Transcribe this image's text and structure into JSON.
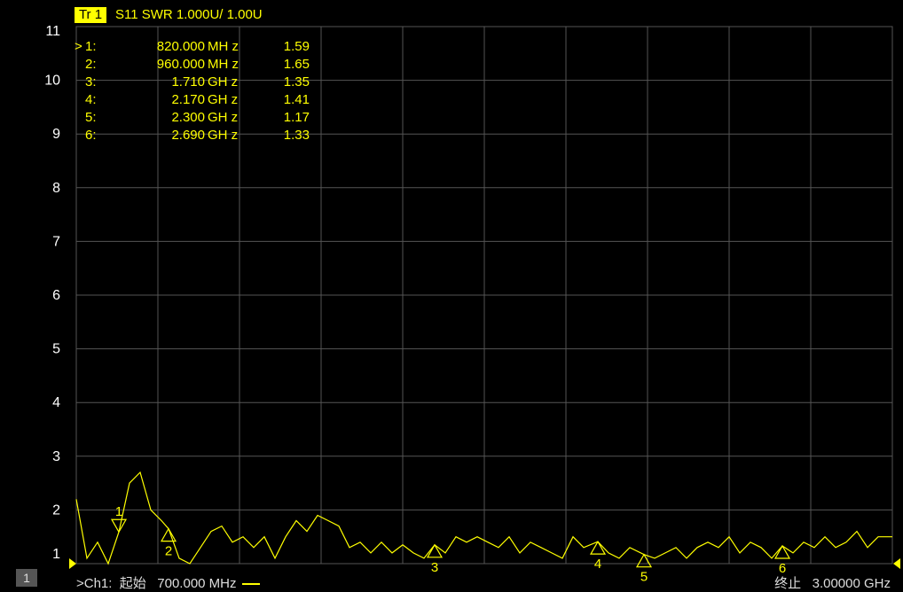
{
  "header": {
    "trace_badge": "Tr 1",
    "trace_label": "S11 SWR 1.000U/  1.00U"
  },
  "markers": [
    {
      "sel": ">",
      "id": "1:",
      "freq": "820.000",
      "unit": "MH z",
      "value": "1.59",
      "label": "1"
    },
    {
      "sel": "",
      "id": "2:",
      "freq": "960.000",
      "unit": "MH z",
      "value": "1.65",
      "label": "2"
    },
    {
      "sel": "",
      "id": "3:",
      "freq": "1.710",
      "unit": "GH z",
      "value": "1.35",
      "label": "3"
    },
    {
      "sel": "",
      "id": "4:",
      "freq": "2.170",
      "unit": "GH z",
      "value": "1.41",
      "label": "4"
    },
    {
      "sel": "",
      "id": "5:",
      "freq": "2.300",
      "unit": "GH z",
      "value": "1.17",
      "label": "5"
    },
    {
      "sel": "",
      "id": "6:",
      "freq": "2.690",
      "unit": "GH z",
      "value": "1.33",
      "label": "6"
    }
  ],
  "footer": {
    "channel": "1",
    "start": ">Ch1:  起始   700.000 MHz",
    "stop": "终止   3.00000 GHz"
  },
  "colors": {
    "trace": "#ffff00",
    "grid": "#555555",
    "background": "#000000"
  },
  "chart_data": {
    "type": "line",
    "title": "S11 SWR 1.000U/  1.00U",
    "xlabel": "",
    "ylabel": "",
    "xlim": [
      700,
      3000
    ],
    "ylim": [
      1,
      11
    ],
    "x_unit": "MHz",
    "yticks": [
      1,
      2,
      3,
      4,
      5,
      6,
      7,
      8,
      9,
      10,
      11
    ],
    "grid": true,
    "series": [
      {
        "x": [
          700,
          730,
          760,
          790,
          820,
          850,
          880,
          910,
          940,
          960,
          990,
          1020,
          1050,
          1080,
          1110,
          1140,
          1170,
          1200,
          1230,
          1260,
          1290,
          1320,
          1350,
          1380,
          1410,
          1440,
          1470,
          1500,
          1530,
          1560,
          1590,
          1620,
          1650,
          1680,
          1710,
          1740,
          1770,
          1800,
          1830,
          1860,
          1890,
          1920,
          1950,
          1980,
          2010,
          2040,
          2070,
          2100,
          2130,
          2170,
          2200,
          2230,
          2260,
          2300,
          2330,
          2360,
          2390,
          2420,
          2450,
          2480,
          2510,
          2540,
          2570,
          2600,
          2630,
          2660,
          2690,
          2720,
          2750,
          2780,
          2810,
          2840,
          2870,
          2900,
          2930,
          2960,
          3000
        ],
        "y": [
          2.2,
          1.1,
          1.4,
          1.0,
          1.59,
          2.5,
          2.7,
          2.0,
          1.8,
          1.65,
          1.1,
          1.0,
          1.3,
          1.6,
          1.7,
          1.4,
          1.5,
          1.3,
          1.5,
          1.1,
          1.5,
          1.8,
          1.6,
          1.9,
          1.8,
          1.7,
          1.3,
          1.4,
          1.2,
          1.4,
          1.2,
          1.35,
          1.2,
          1.1,
          1.35,
          1.2,
          1.5,
          1.4,
          1.5,
          1.4,
          1.3,
          1.5,
          1.2,
          1.4,
          1.3,
          1.2,
          1.1,
          1.5,
          1.3,
          1.41,
          1.2,
          1.1,
          1.3,
          1.17,
          1.1,
          1.2,
          1.3,
          1.1,
          1.3,
          1.4,
          1.3,
          1.5,
          1.2,
          1.4,
          1.3,
          1.1,
          1.33,
          1.2,
          1.4,
          1.3,
          1.5,
          1.3,
          1.4,
          1.6,
          1.3,
          1.5,
          1.5
        ]
      }
    ],
    "markers": [
      {
        "label": "1",
        "x": 820,
        "y": 1.59,
        "direction": "down"
      },
      {
        "label": "2",
        "x": 960,
        "y": 1.65,
        "direction": "up"
      },
      {
        "label": "3",
        "x": 1710,
        "y": 1.35,
        "direction": "up"
      },
      {
        "label": "4",
        "x": 2170,
        "y": 1.41,
        "direction": "up"
      },
      {
        "label": "5",
        "x": 2300,
        "y": 1.17,
        "direction": "up"
      },
      {
        "label": "6",
        "x": 2690,
        "y": 1.33,
        "direction": "up"
      }
    ]
  }
}
